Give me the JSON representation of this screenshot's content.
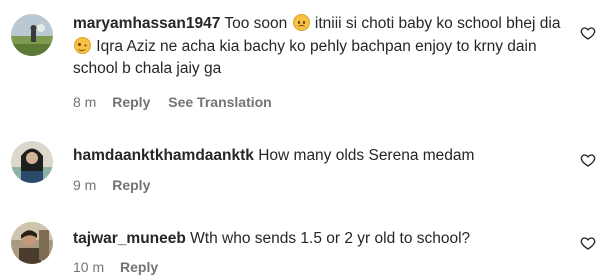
{
  "comments": [
    {
      "username": "maryamhassan1947",
      "text_part1": " Too soon ",
      "emoji1": "sad-face-emoji",
      "text_part2": " itniii si choti baby ko school bhej dia ",
      "emoji2": "smirk-face-emoji",
      "text_part3": " Iqra Aziz ne acha kia bachy ko pehly bachpan enjoy to krny dain school b chala jaiy ga",
      "time": "8 m",
      "reply_label": "Reply",
      "translate_label": "See Translation"
    },
    {
      "username": "hamdaanktkhamdaanktk",
      "text": " How many olds Serena medam",
      "time": "9 m",
      "reply_label": "Reply"
    },
    {
      "username": "tajwar_muneeb",
      "text": " Wth who sends 1.5 or 2 yr old to school?",
      "time": "10 m",
      "reply_label": "Reply"
    }
  ],
  "icons": {
    "like": "heart-outline-icon"
  },
  "colors": {
    "text": "#262626",
    "secondary": "#737373"
  }
}
